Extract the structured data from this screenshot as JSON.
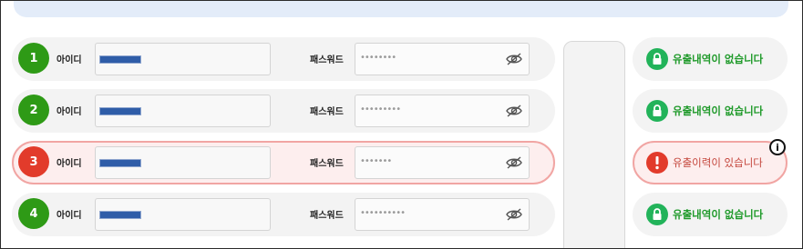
{
  "labels": {
    "id": "아이디",
    "password": "패스워드"
  },
  "rows": [
    {
      "number": "1",
      "password_mask": "••••••••",
      "status": "유출내역이 없습니다",
      "leaked": false
    },
    {
      "number": "2",
      "password_mask": "•••••••••",
      "status": "유출내역이 없습니다",
      "leaked": false
    },
    {
      "number": "3",
      "password_mask": "•••••••",
      "status": "유출이력이 있습니다",
      "leaked": true
    },
    {
      "number": "4",
      "password_mask": "••••••••••",
      "status": "유출내역이 없습니다",
      "leaked": false
    }
  ],
  "info_icon": "i",
  "icons": {
    "safe": "lock-icon",
    "alert": "exclamation-icon",
    "toggle": "eye-slash-icon",
    "info": "info-icon"
  },
  "colors": {
    "safe_green": "#2e9a16",
    "alert_red": "#e23b2b",
    "alert_border": "#f1a5a3",
    "masked_id": "#2f5da8"
  }
}
